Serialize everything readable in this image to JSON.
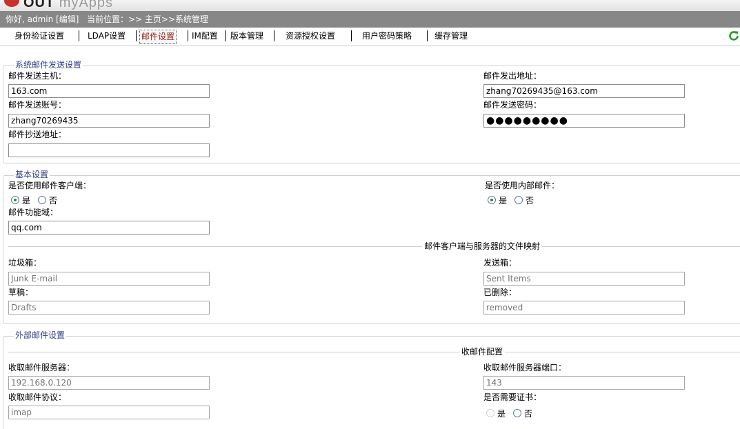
{
  "app": {
    "logo_text": "OUT",
    "logo_text_light": "myApps"
  },
  "infobar": {
    "greeting": "你好, admin [编辑]",
    "location": "当前位置：>> 主页>>系统管理"
  },
  "tabs": [
    {
      "label": "身份验证设置"
    },
    {
      "label": "LDAP设置"
    },
    {
      "label": "邮件设置"
    },
    {
      "label": "IM配置"
    },
    {
      "label": "版本管理"
    },
    {
      "label": "资源授权设置"
    },
    {
      "label": "用户密码策略"
    },
    {
      "label": "缓存管理"
    }
  ],
  "active_tab": "邮件设置",
  "sections": {
    "send": {
      "legend": "系统邮件发送设置",
      "host_label": "邮件发送主机：",
      "host_value": "163.com",
      "from_label": "邮件发出地址：",
      "from_value": "zhang70269435@163.com",
      "account_label": "邮件发送账号：",
      "account_value": "zhang70269435",
      "password_label": "邮件发送密码：",
      "password_value": "●●●●●●●●●",
      "cc_label": "邮件抄送地址：",
      "cc_value": ""
    },
    "basic": {
      "legend": "基本设置",
      "client_label": "是否使用邮件客户端：",
      "internal_label": "是否使用内部邮件：",
      "yes": "是",
      "no": "否",
      "client_choice": "是",
      "internal_choice": "是",
      "domain_label": "邮件功能域：",
      "domain_value": "qq.com",
      "mapping_title": "邮件客户端与服务器的文件映射",
      "trash_label": "垃圾箱：",
      "trash_placeholder": "Junk E-mail",
      "sent_label": "发送箱：",
      "sent_placeholder": "Sent Items",
      "draft_label": "草稿：",
      "draft_placeholder": "Drafts",
      "deleted_label": "已删除：",
      "deleted_placeholder": "removed"
    },
    "external": {
      "legend": "外部邮件设置",
      "receive_title": "收邮件配置",
      "server_label": "收取邮件服务器：",
      "server_placeholder": "192.168.0.120",
      "port_label": "收取邮件服务器端口：",
      "port_placeholder": "143",
      "protocol_label": "收取邮件协议：",
      "protocol_placeholder": "imap",
      "cert_label": "是否需要证书：",
      "yes": "是",
      "no": "否",
      "cert_choice": "否"
    }
  },
  "colors": {
    "infobar_bg": "#878787",
    "active_tab_text": "#9b1e14",
    "legend_text": "#2e3e80"
  }
}
